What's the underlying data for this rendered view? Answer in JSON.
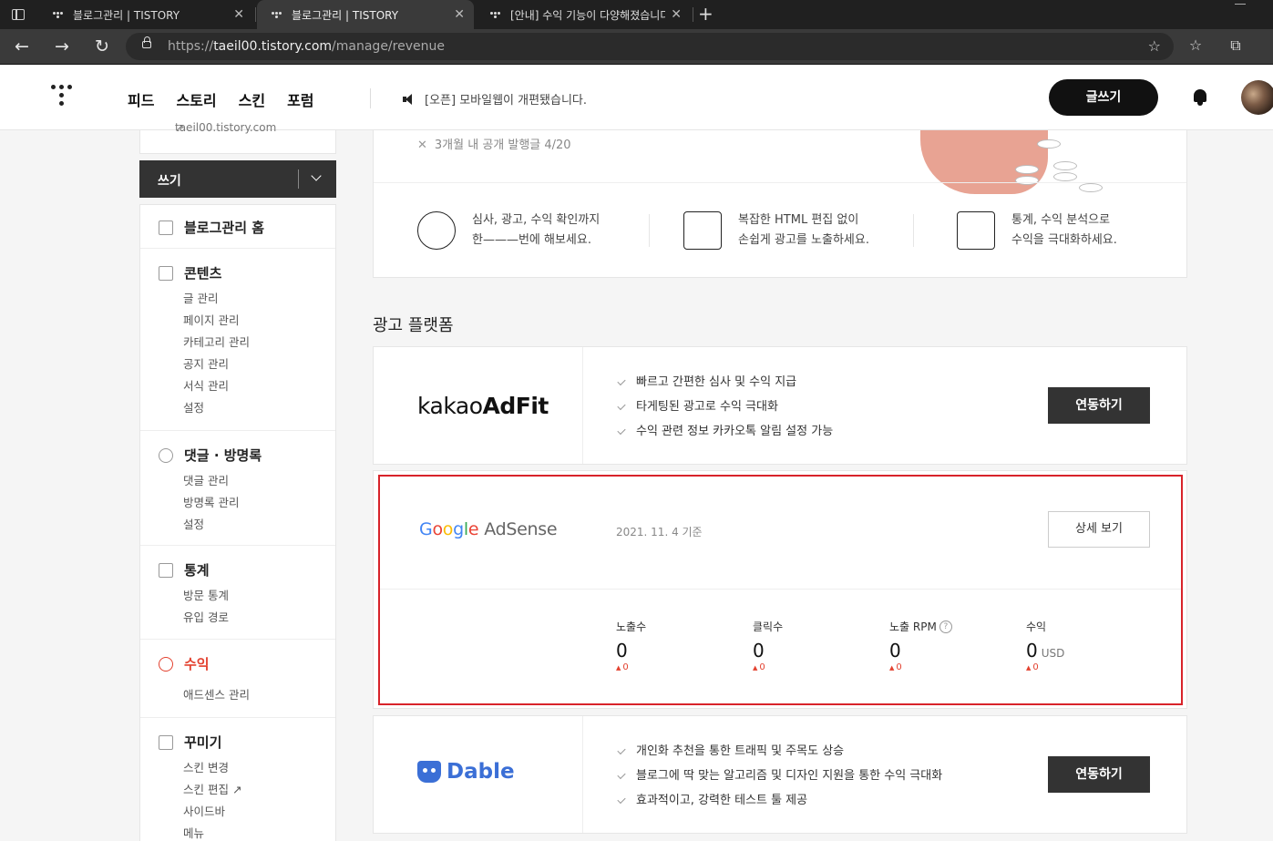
{
  "browser": {
    "tabs": [
      {
        "title": "블로그관리 | TISTORY",
        "active": false
      },
      {
        "title": "블로그관리 | TISTORY",
        "active": true
      },
      {
        "title": "[안내] 수익 기능이 다양해졌습니다",
        "active": false
      }
    ],
    "url_prefix": "https://",
    "url_host": "taeil00.tistory.com",
    "url_path": "/manage/revenue"
  },
  "header": {
    "nav": [
      "피드",
      "스토리",
      "스킨",
      "포럼"
    ],
    "notice": "[오픈] 모바일웹이 개편됐습니다.",
    "write_button": "글쓰기"
  },
  "sidebar": {
    "blog_url": "taeil00.tistory.com",
    "write_label": "쓰기",
    "home": "블로그관리 홈",
    "content": {
      "title": "콘텐츠",
      "items": [
        "글 관리",
        "페이지 관리",
        "카테고리 관리",
        "공지 관리",
        "서식 관리",
        "설정"
      ]
    },
    "comments": {
      "title": "댓글 · 방명록",
      "items": [
        "댓글 관리",
        "방명록 관리",
        "설정"
      ]
    },
    "stats": {
      "title": "통계",
      "items": [
        "방문 통계",
        "유입 경로"
      ]
    },
    "revenue": {
      "title": "수익",
      "items": [
        "애드센스 관리"
      ]
    },
    "design": {
      "title": "꾸미기",
      "items": [
        "스킨 변경",
        "스킨 편집",
        "사이드바",
        "메뉴"
      ]
    }
  },
  "hero": {
    "condition": "3개월 내 공개 발행글 4/20",
    "features": [
      {
        "line1": "심사, 광고, 수익 확인까지",
        "line2": "한———번에 해보세요."
      },
      {
        "line1": "복잡한 HTML 편집 없이",
        "line2": "손쉽게 광고를 노출하세요."
      },
      {
        "line1": "통계, 수익 분석으로",
        "line2": "수익을 극대화하세요."
      }
    ]
  },
  "platforms": {
    "title": "광고 플랫폼",
    "kakao": {
      "logo_light": "kakao",
      "logo_bold": "AdFit",
      "points": [
        "빠르고 간편한 심사 및 수익 지급",
        "타게팅된 광고로 수익 극대화",
        "수익 관련 정보 카카오톡 알림 설정 가능"
      ],
      "button": "연동하기"
    },
    "adsense": {
      "logo_google": "Google",
      "logo_product": "AdSense",
      "date": "2021. 11. 4 기준",
      "button": "상세 보기",
      "stats": [
        {
          "label": "노출수",
          "value": "0",
          "delta": "0"
        },
        {
          "label": "클릭수",
          "value": "0",
          "delta": "0"
        },
        {
          "label": "노출 RPM",
          "value": "0",
          "delta": "0",
          "help": "?"
        },
        {
          "label": "수익",
          "value": "0",
          "unit": "USD",
          "delta": "0"
        }
      ]
    },
    "dable": {
      "logo": "Dable",
      "points": [
        "개인화 추천을 통한 트래픽 및 주목도 상승",
        "블로그에 딱 맞는 알고리즘 및 디자인 지원을 통한 수익 극대화",
        "효과적이고, 강력한 테스트 툴 제공"
      ],
      "button": "연동하기"
    }
  },
  "colors": {
    "accent": "#e3412f",
    "adsense_border": "#d8232a",
    "dable": "#3b6fd6",
    "google_blue": "#4285f4",
    "google_red": "#ea4335",
    "google_yellow": "#fbbc05",
    "google_green": "#34a853"
  }
}
